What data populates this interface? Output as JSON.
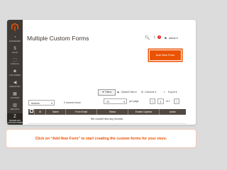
{
  "sidebar": {
    "items": [
      {
        "label": "DASHBOARD",
        "icon": "dashboard-icon",
        "glyph": "◔"
      },
      {
        "label": "SALES",
        "icon": "dollar-icon",
        "glyph": "$"
      },
      {
        "label": "CATALOG",
        "icon": "cube-icon",
        "glyph": "⬚"
      },
      {
        "label": "CUSTOMERS",
        "icon": "person-icon",
        "glyph": "☻"
      },
      {
        "label": "MARKETING",
        "icon": "megaphone-icon",
        "glyph": "◀"
      },
      {
        "label": "CONTENT",
        "icon": "layout-icon",
        "glyph": "▦"
      },
      {
        "label": "REPORTS",
        "icon": "chart-icon",
        "glyph": "▥"
      },
      {
        "label": "MAGEPLAZA CUSTOM FORMS",
        "icon": "forms-icon",
        "glyph": "Z"
      }
    ]
  },
  "header": {
    "title": "Multiple Custom Forms",
    "notification_count": "2",
    "user_label": "admin ▾"
  },
  "add_button_label": "Add New Form",
  "toolbar": {
    "filters_label": "▼ Filters",
    "view_label": "Default View ▾",
    "columns_label": "Columns ▾",
    "export_label": "Export ▾",
    "actions_label": "Actions",
    "records_found": "0 records found",
    "per_page_value": "20",
    "per_page_label": "per page",
    "page_value": "1",
    "page_of": "of 1"
  },
  "table": {
    "columns": [
      "ID",
      "Name",
      "Form Email",
      "Status",
      "Enable Captcha",
      "Action"
    ],
    "empty_message": "We couldn't find any records."
  },
  "caption": "Click on “Add New Form” to start creating the custom forms for your store.",
  "colors": {
    "accent": "#eb5202",
    "sidebar": "#3f3a36",
    "table_header": "#514943"
  }
}
